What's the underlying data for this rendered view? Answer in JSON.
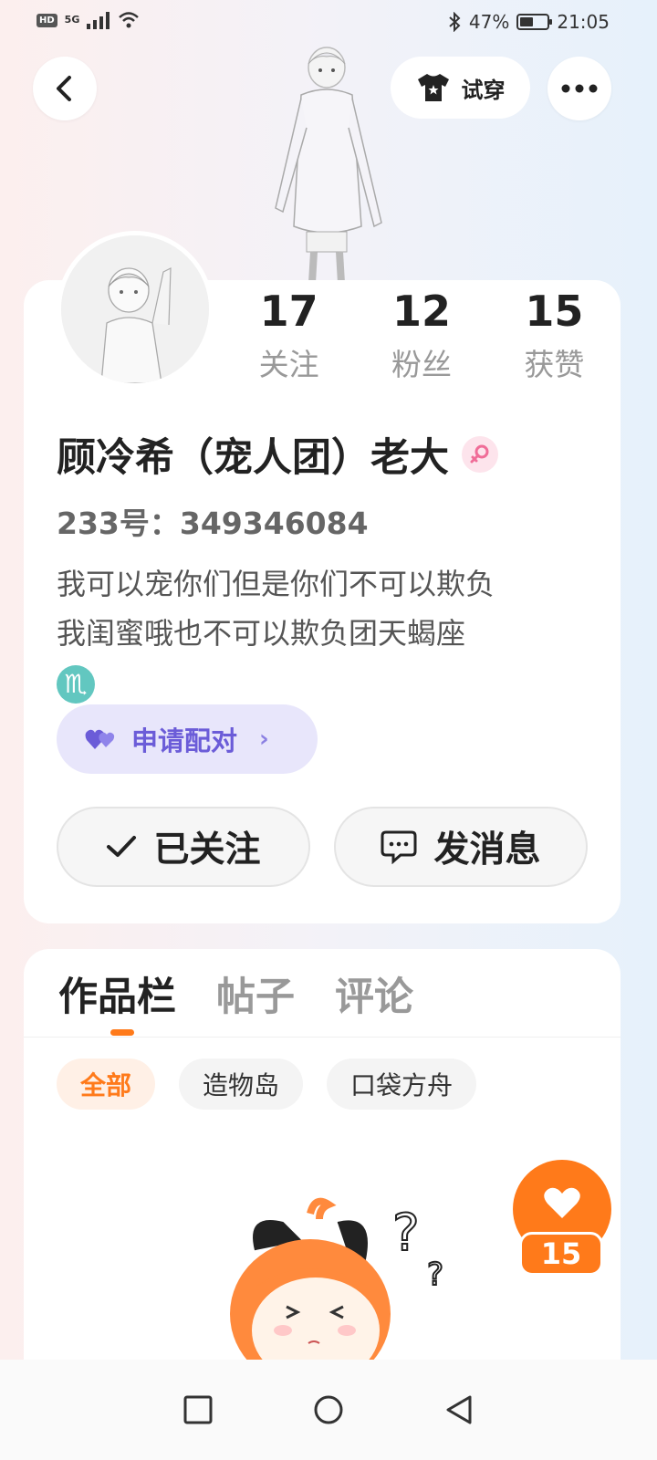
{
  "status_bar": {
    "network_hd": "HD",
    "network_5g": "5G",
    "battery_percent": "47%",
    "battery_level": 0.47,
    "time": "21:05"
  },
  "header": {
    "try_on_label": "试穿"
  },
  "profile": {
    "stats": [
      {
        "value": "17",
        "label": "关注"
      },
      {
        "value": "12",
        "label": "粉丝"
      },
      {
        "value": "15",
        "label": "获赞"
      }
    ],
    "username": "顾冷希（宠人团）老大",
    "gender_symbol": "♀",
    "uid_label": "233号：349346084",
    "bio_line1": "我可以宠你们但是你们不可以欺负",
    "bio_line2": "我闺蜜哦也不可以欺负团天蝎座",
    "zodiac_symbol": "♏",
    "pair_button": "申请配对",
    "follow_button": "已关注",
    "message_button": "发消息"
  },
  "works": {
    "tabs": [
      "作品栏",
      "帖子",
      "评论"
    ],
    "chips": [
      "全部",
      "造物岛",
      "口袋方舟"
    ]
  },
  "like_fab": {
    "count": "15"
  },
  "colors": {
    "accent_orange": "#ff7a1a",
    "pair_purple": "#6b5cd8",
    "pink_gender": "#f06d98",
    "zodiac_teal": "#62c7c0"
  }
}
